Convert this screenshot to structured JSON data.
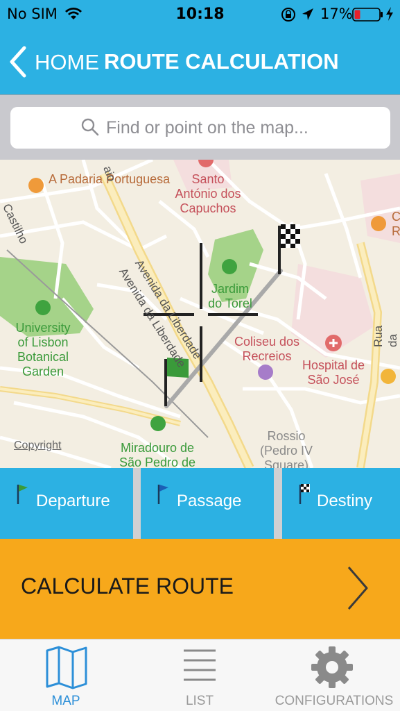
{
  "status_bar": {
    "carrier": "No SIM",
    "time": "10:18",
    "battery": "17%"
  },
  "nav": {
    "back_label": "HOME",
    "title": "ROUTE CALCULATION"
  },
  "search": {
    "placeholder": "Find or point on the map..."
  },
  "map": {
    "labels": {
      "padaria": "A Padaria Portuguesa",
      "santo": "Santo António dos Capuchos",
      "castilho": "Castilho",
      "jardim": "Jardim do Torel",
      "university": "University of Lisbon Botanical Garden",
      "coliseu": "Coliseu dos Recreios",
      "hospital": "Hospital de São José",
      "miradouro": "Miradouro de São Pedro de",
      "rossio": "Rossio (Pedro IV Square)",
      "avenida1": "Avenida da Liberdade",
      "avenida2": "Avenida da Liberdade",
      "rua_palma": "Rua da Palma",
      "ao": "aio",
      "c_edge": "C R"
    },
    "copyright": "Copyright"
  },
  "flags": {
    "departure": "Departure",
    "passage": "Passage",
    "destiny": "Destiny"
  },
  "calculate": {
    "label": "CALCULATE ROUTE"
  },
  "tabs": [
    {
      "label": "MAP",
      "icon": "map-icon",
      "active": true
    },
    {
      "label": "LIST",
      "icon": "list-icon",
      "active": false
    },
    {
      "label": "CONFIGURATIONS",
      "icon": "gear-icon",
      "active": false
    }
  ],
  "colors": {
    "accent": "#2cb1e3",
    "calculate": "#f7a81b",
    "tab_active": "#2c8fd8"
  }
}
